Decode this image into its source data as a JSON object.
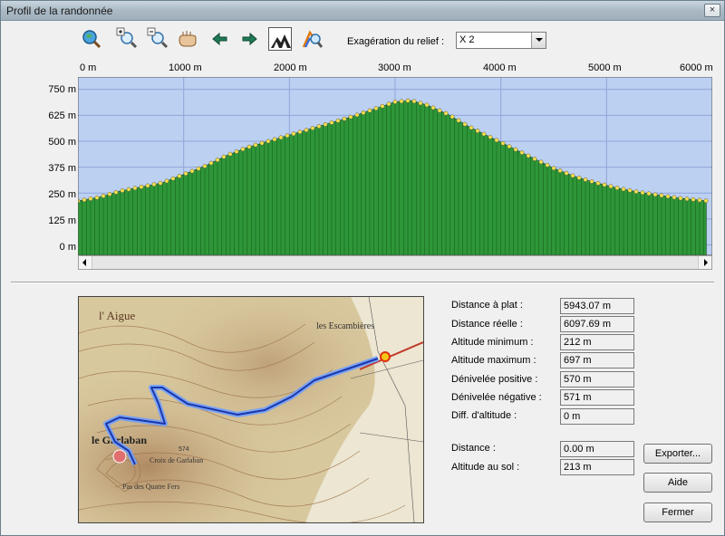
{
  "window": {
    "title": "Profil de la randonnée",
    "close_label": "×"
  },
  "toolbar": {
    "icons": [
      "zoom-globe-icon",
      "zoom-in-icon",
      "zoom-out-icon",
      "hand-pan-icon",
      "arrow-left-icon",
      "arrow-right-icon",
      "relief-view-icon",
      "map-magnify-icon"
    ],
    "exaggeration_label": "Exagération du relief :",
    "exaggeration_value": "X 2"
  },
  "chart_data": {
    "type": "area",
    "xlabel": "",
    "ylabel": "",
    "x_tick_labels": [
      "0 m",
      "1000 m",
      "2000 m",
      "3000 m",
      "4000 m",
      "5000 m",
      "6000 m"
    ],
    "y_tick_labels": [
      "750 m",
      "625 m",
      "500 m",
      "375 m",
      "250 m",
      "125 m",
      "0 m"
    ],
    "x_range": [
      0,
      6000
    ],
    "y_range": [
      -50,
      810
    ],
    "grid": true,
    "fill_color": "#2e9638",
    "plot_background": "#bcd0f2",
    "marker_color": "#f5e04a",
    "x": [
      0,
      200,
      400,
      600,
      800,
      1000,
      1200,
      1400,
      1600,
      1800,
      2000,
      2200,
      2400,
      2600,
      2800,
      3000,
      3150,
      3300,
      3500,
      3700,
      3900,
      4100,
      4300,
      4500,
      4700,
      4900,
      5100,
      5300,
      5500,
      5700,
      5943
    ],
    "y": [
      212,
      230,
      260,
      280,
      300,
      340,
      380,
      430,
      470,
      500,
      530,
      560,
      590,
      620,
      655,
      690,
      697,
      675,
      630,
      570,
      520,
      470,
      420,
      370,
      330,
      300,
      275,
      255,
      240,
      225,
      213
    ]
  },
  "map": {
    "labels": [
      "l' Aigue",
      "les Escambières",
      "le Garlaban",
      "Croix de Garlaban",
      "Pas des Quatre Fers",
      "574"
    ]
  },
  "stats": [
    {
      "label": "Distance à plat :",
      "value": "5943.07 m"
    },
    {
      "label": "Distance réelle :",
      "value": "6097.69 m"
    },
    {
      "label": "Altitude minimum :",
      "value": "212 m"
    },
    {
      "label": "Altitude maximum :",
      "value": "697 m"
    },
    {
      "label": "Dénivelée positive :",
      "value": "570 m"
    },
    {
      "label": "Dénivelée négative :",
      "value": "571 m"
    },
    {
      "label": "Diff. d'altitude :",
      "value": "0 m"
    }
  ],
  "cursor": [
    {
      "label": "Distance :",
      "value": "0.00 m"
    },
    {
      "label": "Altitude au sol :",
      "value": "213 m"
    }
  ],
  "buttons": {
    "export": "Exporter...",
    "help": "Aide",
    "close": "Fermer"
  }
}
